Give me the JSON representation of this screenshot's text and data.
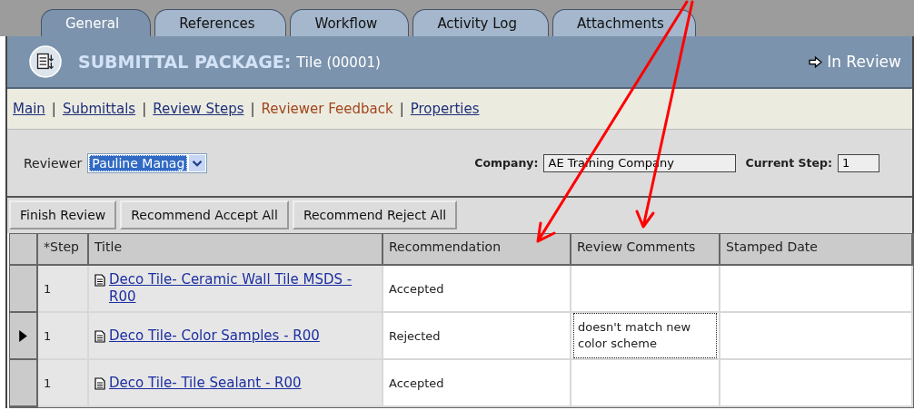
{
  "tabs": [
    {
      "label": "General",
      "selected": true
    },
    {
      "label": "References",
      "selected": false
    },
    {
      "label": "Workflow",
      "selected": false
    },
    {
      "label": "Activity Log",
      "selected": false
    },
    {
      "label": "Attachments",
      "selected": false
    }
  ],
  "header": {
    "title": "SUBMITTAL PACKAGE:",
    "name": "Tile",
    "number": "(00001)",
    "status": "In Review"
  },
  "nav": [
    {
      "label": "Main",
      "selected": false
    },
    {
      "label": "Submittals",
      "selected": false
    },
    {
      "label": "Review Steps",
      "selected": false
    },
    {
      "label": "Reviewer Feedback",
      "selected": true
    },
    {
      "label": "Properties",
      "selected": false
    }
  ],
  "nav_separator": "|",
  "form": {
    "reviewer_label": "Reviewer",
    "reviewer": "Pauline Manag",
    "company_label": "Company:",
    "company": "AE Training Company",
    "step_label": "Current Step:",
    "step": "1"
  },
  "buttons": [
    "Finish Review",
    "Recommend Accept All",
    "Recommend Reject All"
  ],
  "table": {
    "columns": [
      "*Step",
      "Title",
      "Recommendation",
      "Review Comments",
      "Stamped Date"
    ],
    "rows": [
      {
        "step": "1",
        "title": "Deco Tile- Ceramic Wall Tile MSDS - R00",
        "recommendation": "Accepted",
        "comments": "",
        "selected": false
      },
      {
        "step": "1",
        "title": "Deco Tile- Color Samples - R00",
        "recommendation": "Rejected",
        "comments": "doesn't match new color scheme",
        "selected": true
      },
      {
        "step": "1",
        "title": "Deco Tile- Tile Sealant - R00",
        "recommendation": "Accepted",
        "comments": "",
        "selected": false
      }
    ]
  }
}
